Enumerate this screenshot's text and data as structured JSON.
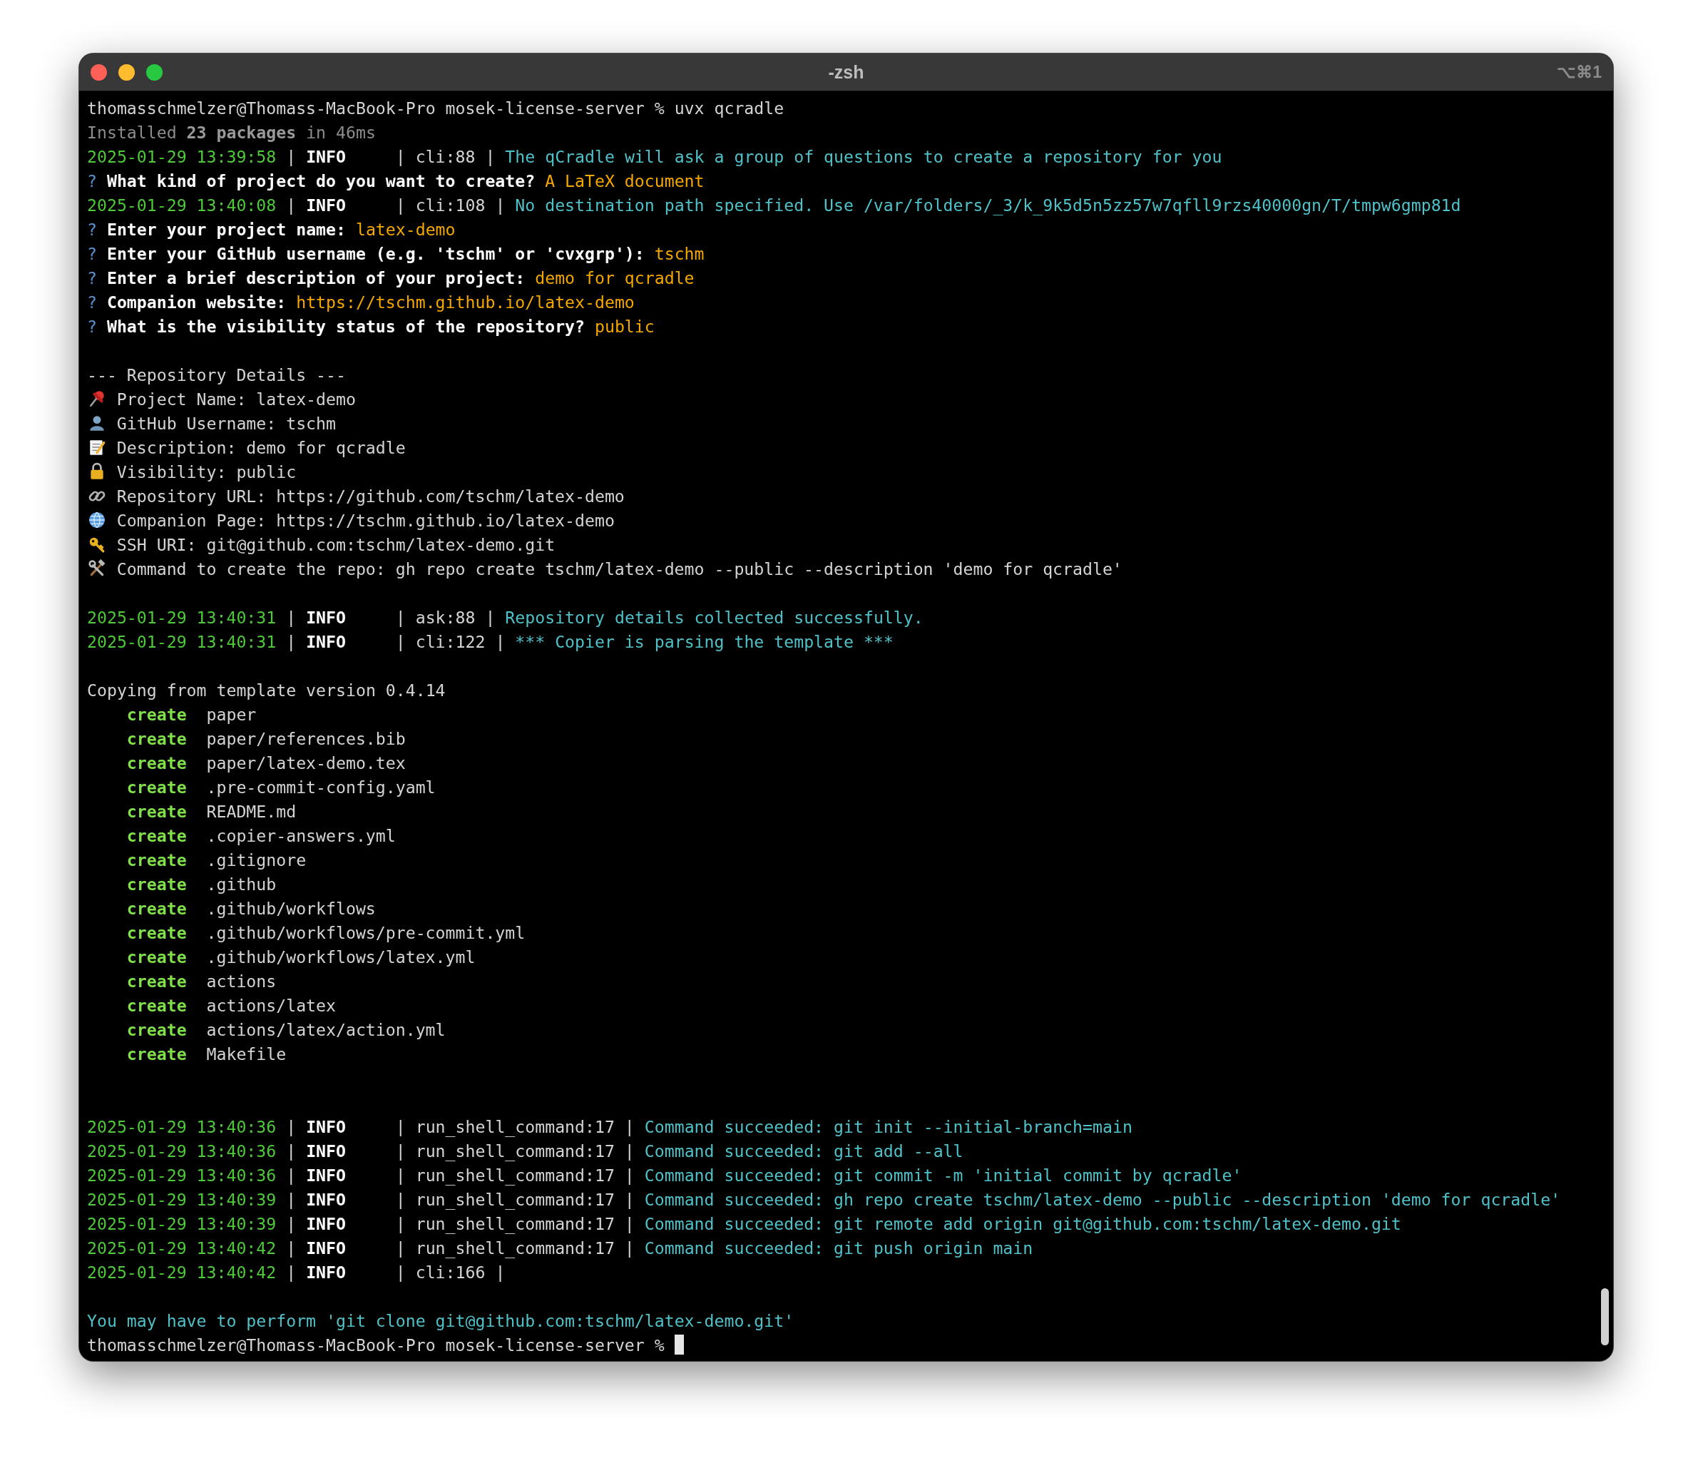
{
  "window": {
    "title": "-zsh",
    "shortcut": "⌥⌘1"
  },
  "lines": [
    {
      "kind": "log",
      "segments": [
        {
          "kind": "plain",
          "text": "thomasschmelzer@Thomass-MacBook-Pro mosek-license-server % uvx qcradle"
        }
      ]
    },
    {
      "kind": "log",
      "segments": [
        {
          "kind": "dim",
          "text": "Installed "
        },
        {
          "kind": "dim-bold",
          "text": "23 packages"
        },
        {
          "kind": "dim",
          "text": " in 46ms"
        }
      ]
    },
    {
      "kind": "log",
      "segments": [
        {
          "kind": "timestamp",
          "text": "2025-01-29 13:39:58"
        },
        {
          "kind": "plain",
          "text": " | "
        },
        {
          "kind": "level",
          "text": "INFO"
        },
        {
          "kind": "plain",
          "text": "     | cli:88 | "
        },
        {
          "kind": "message",
          "text": "The qCradle will ask a group of questions to create a repository for you"
        }
      ]
    },
    {
      "kind": "log",
      "segments": [
        {
          "kind": "marker",
          "text": "?"
        },
        {
          "kind": "question",
          "text": " What kind of project do you want to create? "
        },
        {
          "kind": "answer",
          "text": "A LaTeX document"
        }
      ]
    },
    {
      "kind": "log",
      "segments": [
        {
          "kind": "timestamp",
          "text": "2025-01-29 13:40:08"
        },
        {
          "kind": "plain",
          "text": " | "
        },
        {
          "kind": "level",
          "text": "INFO"
        },
        {
          "kind": "plain",
          "text": "     | cli:108 | "
        },
        {
          "kind": "message",
          "text": "No destination path specified. Use /var/folders/_3/k_9k5d5n5zz57w7qfll9rzs40000gn/T/tmpw6gmp81d"
        }
      ]
    },
    {
      "kind": "log",
      "segments": [
        {
          "kind": "marker",
          "text": "?"
        },
        {
          "kind": "question",
          "text": " Enter your project name: "
        },
        {
          "kind": "answer",
          "text": "latex-demo"
        }
      ]
    },
    {
      "kind": "log",
      "segments": [
        {
          "kind": "marker",
          "text": "?"
        },
        {
          "kind": "question",
          "text": " Enter your GitHub username (e.g. 'tschm' or 'cvxgrp'): "
        },
        {
          "kind": "answer",
          "text": "tschm"
        }
      ]
    },
    {
      "kind": "log",
      "segments": [
        {
          "kind": "marker",
          "text": "?"
        },
        {
          "kind": "question",
          "text": " Enter a brief description of your project: "
        },
        {
          "kind": "answer",
          "text": "demo for qcradle"
        }
      ]
    },
    {
      "kind": "log",
      "segments": [
        {
          "kind": "marker",
          "text": "?"
        },
        {
          "kind": "question",
          "text": " Companion website: "
        },
        {
          "kind": "answer",
          "text": "https://tschm.github.io/latex-demo"
        }
      ]
    },
    {
      "kind": "log",
      "segments": [
        {
          "kind": "marker",
          "text": "?"
        },
        {
          "kind": "question",
          "text": " What is the visibility status of the repository? "
        },
        {
          "kind": "answer",
          "text": "public"
        }
      ]
    },
    {
      "kind": "blank"
    },
    {
      "kind": "log",
      "segments": [
        {
          "kind": "plain",
          "text": "--- Repository Details ---"
        }
      ]
    },
    {
      "kind": "pin",
      "text": "Project Name: latex-demo"
    },
    {
      "kind": "person",
      "text": "GitHub Username: tschm"
    },
    {
      "kind": "memo",
      "text": "Description: demo for qcradle"
    },
    {
      "kind": "lock",
      "text": "Visibility: public"
    },
    {
      "kind": "link",
      "text": "Repository URL: https://github.com/tschm/latex-demo"
    },
    {
      "kind": "globe",
      "text": "Companion Page: https://tschm.github.io/latex-demo"
    },
    {
      "kind": "key",
      "text": "SSH URI: git@github.com:tschm/latex-demo.git"
    },
    {
      "kind": "tools",
      "text": "Command to create the repo: gh repo create tschm/latex-demo --public --description 'demo for qcradle'"
    },
    {
      "kind": "blank"
    },
    {
      "kind": "log",
      "segments": [
        {
          "kind": "timestamp",
          "text": "2025-01-29 13:40:31"
        },
        {
          "kind": "plain",
          "text": " | "
        },
        {
          "kind": "level",
          "text": "INFO"
        },
        {
          "kind": "plain",
          "text": "     | ask:88 | "
        },
        {
          "kind": "message",
          "text": "Repository details collected successfully."
        }
      ]
    },
    {
      "kind": "log",
      "segments": [
        {
          "kind": "timestamp",
          "text": "2025-01-29 13:40:31"
        },
        {
          "kind": "plain",
          "text": " | "
        },
        {
          "kind": "level",
          "text": "INFO"
        },
        {
          "kind": "plain",
          "text": "     | cli:122 | "
        },
        {
          "kind": "message",
          "text": "*** Copier is parsing the template ***"
        }
      ]
    },
    {
      "kind": "blank"
    },
    {
      "kind": "log",
      "segments": [
        {
          "kind": "plain",
          "text": "Copying from template version 0.4.14"
        }
      ]
    },
    {
      "kind": "create",
      "action": "create",
      "path": "paper"
    },
    {
      "kind": "create",
      "action": "create",
      "path": "paper/references.bib"
    },
    {
      "kind": "create",
      "action": "create",
      "path": "paper/latex-demo.tex"
    },
    {
      "kind": "create",
      "action": "create",
      "path": ".pre-commit-config.yaml"
    },
    {
      "kind": "create",
      "action": "create",
      "path": "README.md"
    },
    {
      "kind": "create",
      "action": "create",
      "path": ".copier-answers.yml"
    },
    {
      "kind": "create",
      "action": "create",
      "path": ".gitignore"
    },
    {
      "kind": "create",
      "action": "create",
      "path": ".github"
    },
    {
      "kind": "create",
      "action": "create",
      "path": ".github/workflows"
    },
    {
      "kind": "create",
      "action": "create",
      "path": ".github/workflows/pre-commit.yml"
    },
    {
      "kind": "create",
      "action": "create",
      "path": ".github/workflows/latex.yml"
    },
    {
      "kind": "create",
      "action": "create",
      "path": "actions"
    },
    {
      "kind": "create",
      "action": "create",
      "path": "actions/latex"
    },
    {
      "kind": "create",
      "action": "create",
      "path": "actions/latex/action.yml"
    },
    {
      "kind": "create",
      "action": "create",
      "path": "Makefile"
    },
    {
      "kind": "blank"
    },
    {
      "kind": "blank"
    },
    {
      "kind": "log",
      "segments": [
        {
          "kind": "timestamp",
          "text": "2025-01-29 13:40:36"
        },
        {
          "kind": "plain",
          "text": " | "
        },
        {
          "kind": "level",
          "text": "INFO"
        },
        {
          "kind": "plain",
          "text": "     | run_shell_command:17 | "
        },
        {
          "kind": "message",
          "text": "Command succeeded: git init --initial-branch=main"
        }
      ]
    },
    {
      "kind": "log",
      "segments": [
        {
          "kind": "timestamp",
          "text": "2025-01-29 13:40:36"
        },
        {
          "kind": "plain",
          "text": " | "
        },
        {
          "kind": "level",
          "text": "INFO"
        },
        {
          "kind": "plain",
          "text": "     | run_shell_command:17 | "
        },
        {
          "kind": "message",
          "text": "Command succeeded: git add --all"
        }
      ]
    },
    {
      "kind": "log",
      "segments": [
        {
          "kind": "timestamp",
          "text": "2025-01-29 13:40:36"
        },
        {
          "kind": "plain",
          "text": " | "
        },
        {
          "kind": "level",
          "text": "INFO"
        },
        {
          "kind": "plain",
          "text": "     | run_shell_command:17 | "
        },
        {
          "kind": "message",
          "text": "Command succeeded: git commit -m 'initial commit by qcradle'"
        }
      ]
    },
    {
      "kind": "log",
      "segments": [
        {
          "kind": "timestamp",
          "text": "2025-01-29 13:40:39"
        },
        {
          "kind": "plain",
          "text": " | "
        },
        {
          "kind": "level",
          "text": "INFO"
        },
        {
          "kind": "plain",
          "text": "     | run_shell_command:17 | "
        },
        {
          "kind": "message",
          "text": "Command succeeded: gh repo create tschm/latex-demo --public --description 'demo for qcradle'"
        }
      ]
    },
    {
      "kind": "log",
      "segments": [
        {
          "kind": "timestamp",
          "text": "2025-01-29 13:40:39"
        },
        {
          "kind": "plain",
          "text": " | "
        },
        {
          "kind": "level",
          "text": "INFO"
        },
        {
          "kind": "plain",
          "text": "     | run_shell_command:17 | "
        },
        {
          "kind": "message",
          "text": "Command succeeded: git remote add origin git@github.com:tschm/latex-demo.git"
        }
      ]
    },
    {
      "kind": "log",
      "segments": [
        {
          "kind": "timestamp",
          "text": "2025-01-29 13:40:42"
        },
        {
          "kind": "plain",
          "text": " | "
        },
        {
          "kind": "level",
          "text": "INFO"
        },
        {
          "kind": "plain",
          "text": "     | run_shell_command:17 | "
        },
        {
          "kind": "message",
          "text": "Command succeeded: git push origin main"
        }
      ]
    },
    {
      "kind": "log",
      "segments": [
        {
          "kind": "timestamp",
          "text": "2025-01-29 13:40:42"
        },
        {
          "kind": "plain",
          "text": " | "
        },
        {
          "kind": "level",
          "text": "INFO"
        },
        {
          "kind": "plain",
          "text": "     | cli:166 |"
        }
      ]
    },
    {
      "kind": "blank"
    },
    {
      "kind": "log",
      "segments": [
        {
          "kind": "message",
          "text": "You may have to perform 'git clone git@github.com:tschm/latex-demo.git'"
        }
      ]
    },
    {
      "kind": "log",
      "cursor": true,
      "segments": [
        {
          "kind": "plain",
          "text": "thomasschmelzer@Thomass-MacBook-Pro mosek-license-server %"
        }
      ]
    }
  ]
}
